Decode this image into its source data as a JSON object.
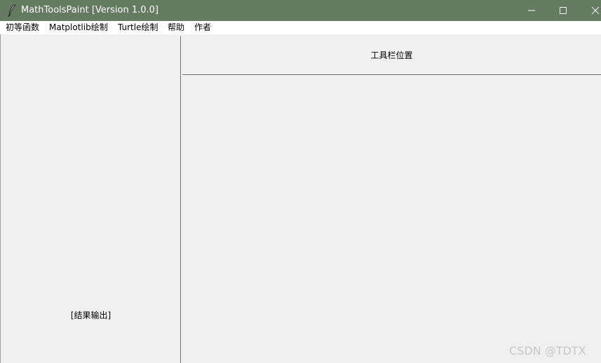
{
  "window": {
    "title": "MathToolsPaint [Version 1.0.0]",
    "titlebar_color": "#647b61",
    "icons": {
      "app": "feather-icon",
      "minimize": "minimize-icon",
      "maximize": "maximize-icon",
      "close": "close-icon"
    }
  },
  "menubar": {
    "items": [
      {
        "label": "初等函数"
      },
      {
        "label": "Matplotlib绘制"
      },
      {
        "label": "Turtle绘制"
      },
      {
        "label": "帮助"
      },
      {
        "label": "作者"
      }
    ]
  },
  "left_panel": {
    "result_label": "[结果输出]"
  },
  "right_panel": {
    "toolbar_label": "工具栏位置"
  },
  "watermark": {
    "text": "CSDN @TDTX"
  }
}
